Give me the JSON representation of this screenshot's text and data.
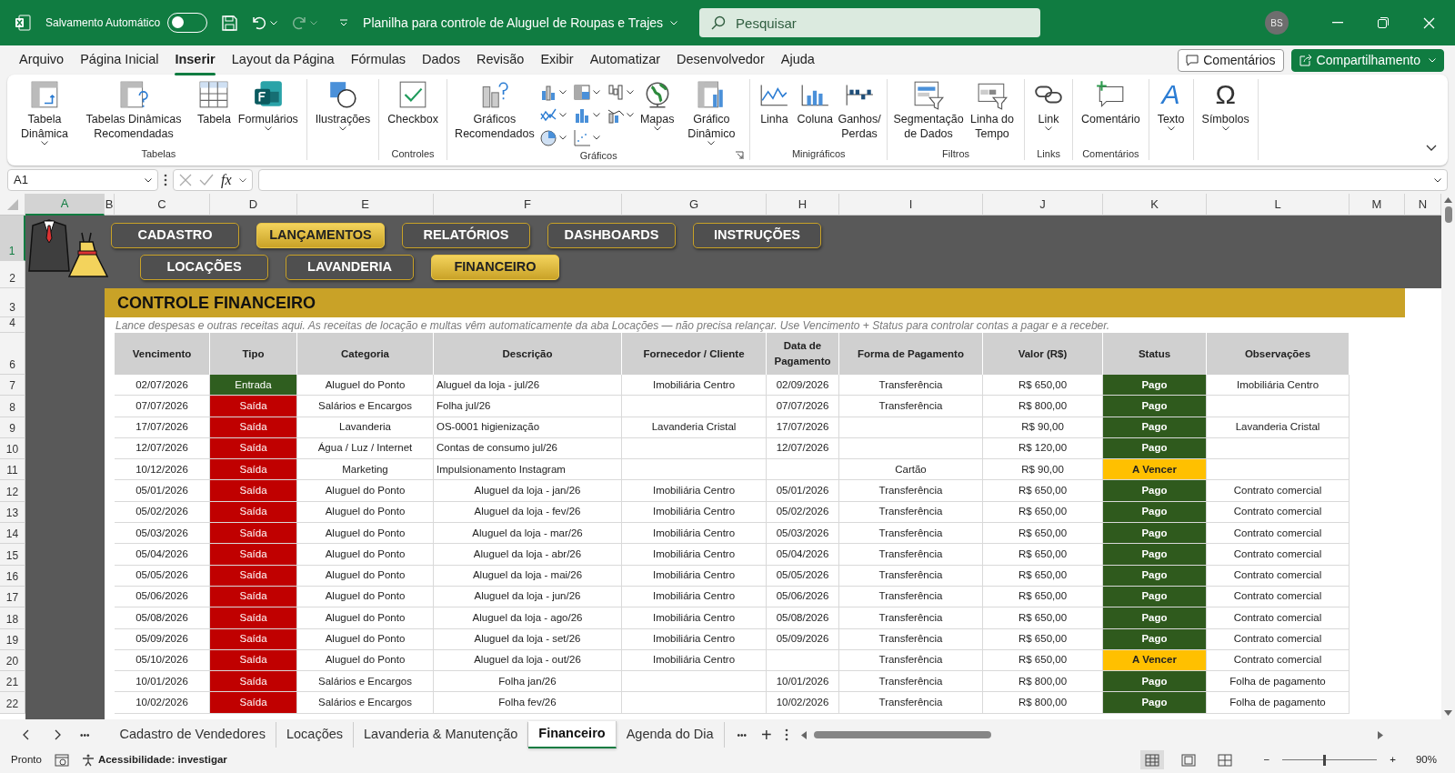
{
  "title_bar": {
    "autosave_label": "Salvamento Automático",
    "autosave_on": false,
    "redo_disabled": true,
    "document_title": "Planilha para controle de Aluguel de Roupas e Trajes",
    "search": {
      "placeholder": "Pesquisar"
    },
    "avatar": "BS"
  },
  "menu_tabs": [
    {
      "label": "Arquivo",
      "selected": false
    },
    {
      "label": "Página Inicial",
      "selected": false
    },
    {
      "label": "Inserir",
      "selected": true
    },
    {
      "label": "Layout da Página",
      "selected": false
    },
    {
      "label": "Fórmulas",
      "selected": false
    },
    {
      "label": "Dados",
      "selected": false
    },
    {
      "label": "Revisão",
      "selected": false
    },
    {
      "label": "Exibir",
      "selected": false
    },
    {
      "label": "Automatizar",
      "selected": false
    },
    {
      "label": "Desenvolvedor",
      "selected": false
    },
    {
      "label": "Ajuda",
      "selected": false
    }
  ],
  "header_buttons": [
    {
      "label": "Comentários",
      "kind": "outline"
    },
    {
      "label": "Compartilhamento",
      "kind": "primary"
    }
  ],
  "ribbon": {
    "groups": [
      {
        "label": "Tabelas",
        "items": [
          {
            "kind": "large",
            "label": "Tabela Dinâmica",
            "caret": true
          },
          {
            "kind": "large",
            "label": "Tabelas Dinâmicas Recomendadas",
            "caret": false
          },
          {
            "kind": "large",
            "label": "Tabela",
            "caret": false
          },
          {
            "kind": "large",
            "label": "Formulários",
            "caret": true
          }
        ]
      },
      {
        "items": [
          {
            "kind": "large",
            "label": "Ilustrações",
            "caret": true
          }
        ]
      },
      {
        "label": "Controles",
        "items": [
          {
            "kind": "large",
            "label": "Checkbox",
            "caret": false
          }
        ]
      },
      {
        "label": "Gráficos",
        "launcher": true,
        "items": [
          {
            "kind": "large",
            "label": "Gráficos Recomendados",
            "caret": false
          },
          {
            "kind": "small_grid",
            "items": [
              {
                "caret": true
              },
              {
                "caret": true
              },
              {
                "caret": true
              },
              {
                "caret": true
              },
              {
                "caret": true
              },
              {
                "caret": true
              },
              {
                "caret": true
              },
              {
                "caret": true
              }
            ]
          },
          {
            "kind": "large",
            "label": "Mapas",
            "caret": true
          },
          {
            "kind": "large",
            "label": "Gráfico Dinâmico",
            "caret": true
          }
        ]
      },
      {
        "label": "Minigráficos",
        "items": [
          {
            "kind": "large",
            "label": "Linha",
            "caret": false
          },
          {
            "kind": "large",
            "label": "Coluna",
            "caret": false
          },
          {
            "kind": "large",
            "label": "Ganhos/ Perdas",
            "caret": false
          }
        ]
      },
      {
        "label": "Filtros",
        "items": [
          {
            "kind": "large",
            "label": "Segmentação de Dados",
            "caret": false
          },
          {
            "kind": "large",
            "label": "Linha do Tempo",
            "caret": false
          }
        ]
      },
      {
        "label": "Links",
        "items": [
          {
            "kind": "large",
            "label": "Link",
            "caret": true
          }
        ]
      },
      {
        "label": "Comentários",
        "items": [
          {
            "kind": "large",
            "label": "Comentário",
            "caret": false
          }
        ]
      },
      {
        "items": [
          {
            "kind": "glyph",
            "glyph": "A",
            "label": "Texto",
            "caret": true
          }
        ]
      },
      {
        "items": [
          {
            "kind": "glyph",
            "glyph": "Ω",
            "label": "Símbolos",
            "caret": true
          }
        ]
      }
    ]
  },
  "formula_bar": {
    "name_box": "A1",
    "fx": "fx"
  },
  "sheet": {
    "columns": [
      {
        "letter": "A",
        "selected": true
      },
      {
        "letter": "B",
        "selected": false
      },
      {
        "letter": "C",
        "selected": false
      },
      {
        "letter": "D",
        "selected": false
      },
      {
        "letter": "E",
        "selected": false
      },
      {
        "letter": "F",
        "selected": false
      },
      {
        "letter": "G",
        "selected": false
      },
      {
        "letter": "H",
        "selected": false
      },
      {
        "letter": "I",
        "selected": false
      },
      {
        "letter": "J",
        "selected": false
      },
      {
        "letter": "K",
        "selected": false
      },
      {
        "letter": "L",
        "selected": false
      },
      {
        "letter": "M",
        "selected": false
      },
      {
        "letter": "N",
        "selected": false
      }
    ],
    "row_headers": [
      {
        "label": "1",
        "selected": true
      },
      {
        "label": "2",
        "selected": false
      },
      {
        "label": "3",
        "selected": false
      },
      {
        "label": "4",
        "selected": false
      },
      {
        "label": "6",
        "selected": false
      },
      {
        "label": "7",
        "selected": false
      },
      {
        "label": "8",
        "selected": false
      },
      {
        "label": "9",
        "selected": false
      },
      {
        "label": "10",
        "selected": false
      },
      {
        "label": "11",
        "selected": false
      },
      {
        "label": "12",
        "selected": false
      },
      {
        "label": "13",
        "selected": false
      },
      {
        "label": "14",
        "selected": false
      },
      {
        "label": "15",
        "selected": false
      },
      {
        "label": "16",
        "selected": false
      },
      {
        "label": "17",
        "selected": false
      },
      {
        "label": "18",
        "selected": false
      },
      {
        "label": "19",
        "selected": false
      },
      {
        "label": "20",
        "selected": false
      },
      {
        "label": "21",
        "selected": false
      },
      {
        "label": "22",
        "selected": false
      }
    ],
    "nav_rows": [
      [
        {
          "label": "CADASTRO",
          "selected": false
        },
        {
          "label": "LANÇAMENTOS",
          "selected": true
        },
        {
          "label": "RELATÓRIOS",
          "selected": false
        },
        {
          "label": "DASHBOARDS",
          "selected": false
        },
        {
          "label": "INSTRUÇÕES",
          "selected": false
        }
      ],
      [
        {
          "label": "LOCAÇÕES",
          "selected": false
        },
        {
          "label": "LAVANDERIA",
          "selected": false
        },
        {
          "label": "FINANCEIRO",
          "selected": true
        }
      ]
    ],
    "title": "CONTROLE FINANCEIRO",
    "note": "Lance despesas e outras receitas aqui. As receitas de locação e multas vêm automaticamente da aba Locações — não precisa relançar. Use Vencimento + Status para controlar contas a pagar e a receber.",
    "headers": [
      "Vencimento",
      "Tipo",
      "Categoria",
      "Descrição",
      "Fornecedor / Cliente",
      "Data de Pagamento",
      "Forma de Pagamento",
      "Valor (R$)",
      "Status",
      "Observações"
    ],
    "rows": [
      {
        "vencimento": "02/07/2026",
        "tipo": {
          "label": "Entrada",
          "kind": "in"
        },
        "categoria": "Aluguel do Ponto",
        "descricao": "Aluguel da loja - jul/26",
        "kind": "left",
        "fornecedor": "Imobiliária Centro",
        "data_pagamento": "02/09/2026",
        "forma": "Transferência",
        "valor": "R$ 650,00",
        "status": {
          "label": "Pago",
          "kind": "paid"
        },
        "observacoes": "Imobiliária Centro"
      },
      {
        "vencimento": "07/07/2026",
        "tipo": {
          "label": "Saída",
          "kind": "out"
        },
        "categoria": "Salários e Encargos",
        "descricao": "Folha jul/26",
        "kind": "left",
        "data_pagamento": "07/07/2026",
        "forma": "Transferência",
        "valor": "R$ 800,00",
        "status": {
          "label": "Pago",
          "kind": "paid"
        }
      },
      {
        "vencimento": "17/07/2026",
        "tipo": {
          "label": "Saída",
          "kind": "out"
        },
        "categoria": "Lavanderia",
        "descricao": "OS-0001 higienização",
        "kind": "left",
        "fornecedor": "Lavanderia Cristal",
        "data_pagamento": "17/07/2026",
        "valor": "R$ 90,00",
        "status": {
          "label": "Pago",
          "kind": "paid"
        },
        "observacoes": "Lavanderia Cristal"
      },
      {
        "vencimento": "12/07/2026",
        "tipo": {
          "label": "Saída",
          "kind": "out"
        },
        "categoria": "Água / Luz / Internet",
        "descricao": "Contas de consumo jul/26",
        "kind": "left",
        "data_pagamento": "12/07/2026",
        "valor": "R$ 120,00",
        "status": {
          "label": "Pago",
          "kind": "paid"
        }
      },
      {
        "vencimento": "10/12/2026",
        "tipo": {
          "label": "Saída",
          "kind": "out"
        },
        "categoria": "Marketing",
        "descricao": "Impulsionamento Instagram",
        "kind": "left",
        "forma": "Cartão",
        "valor": "R$ 90,00",
        "status": {
          "label": "A Vencer",
          "kind": "due"
        }
      },
      {
        "vencimento": "05/01/2026",
        "tipo": {
          "label": "Saída",
          "kind": "out"
        },
        "categoria": "Aluguel do Ponto",
        "descricao": "Aluguel da loja - jan/26",
        "kind": "center",
        "fornecedor": "Imobiliária Centro",
        "data_pagamento": "05/01/2026",
        "forma": "Transferência",
        "valor": "R$ 650,00",
        "status": {
          "label": "Pago",
          "kind": "paid"
        },
        "observacoes": "Contrato comercial"
      },
      {
        "vencimento": "05/02/2026",
        "tipo": {
          "label": "Saída",
          "kind": "out"
        },
        "categoria": "Aluguel do Ponto",
        "descricao": "Aluguel da loja - fev/26",
        "kind": "center",
        "fornecedor": "Imobiliária Centro",
        "data_pagamento": "05/02/2026",
        "forma": "Transferência",
        "valor": "R$ 650,00",
        "status": {
          "label": "Pago",
          "kind": "paid"
        },
        "observacoes": "Contrato comercial"
      },
      {
        "vencimento": "05/03/2026",
        "tipo": {
          "label": "Saída",
          "kind": "out"
        },
        "categoria": "Aluguel do Ponto",
        "descricao": "Aluguel da loja - mar/26",
        "kind": "center",
        "fornecedor": "Imobiliária Centro",
        "data_pagamento": "05/03/2026",
        "forma": "Transferência",
        "valor": "R$ 650,00",
        "status": {
          "label": "Pago",
          "kind": "paid"
        },
        "observacoes": "Contrato comercial"
      },
      {
        "vencimento": "05/04/2026",
        "tipo": {
          "label": "Saída",
          "kind": "out"
        },
        "categoria": "Aluguel do Ponto",
        "descricao": "Aluguel da loja - abr/26",
        "kind": "center",
        "fornecedor": "Imobiliária Centro",
        "data_pagamento": "05/04/2026",
        "forma": "Transferência",
        "valor": "R$ 650,00",
        "status": {
          "label": "Pago",
          "kind": "paid"
        },
        "observacoes": "Contrato comercial"
      },
      {
        "vencimento": "05/05/2026",
        "tipo": {
          "label": "Saída",
          "kind": "out"
        },
        "categoria": "Aluguel do Ponto",
        "descricao": "Aluguel da loja - mai/26",
        "kind": "center",
        "fornecedor": "Imobiliária Centro",
        "data_pagamento": "05/05/2026",
        "forma": "Transferência",
        "valor": "R$ 650,00",
        "status": {
          "label": "Pago",
          "kind": "paid"
        },
        "observacoes": "Contrato comercial"
      },
      {
        "vencimento": "05/06/2026",
        "tipo": {
          "label": "Saída",
          "kind": "out"
        },
        "categoria": "Aluguel do Ponto",
        "descricao": "Aluguel da loja - jun/26",
        "kind": "center",
        "fornecedor": "Imobiliária Centro",
        "data_pagamento": "05/06/2026",
        "forma": "Transferência",
        "valor": "R$ 650,00",
        "status": {
          "label": "Pago",
          "kind": "paid"
        },
        "observacoes": "Contrato comercial"
      },
      {
        "vencimento": "05/08/2026",
        "tipo": {
          "label": "Saída",
          "kind": "out"
        },
        "categoria": "Aluguel do Ponto",
        "descricao": "Aluguel da loja - ago/26",
        "kind": "center",
        "fornecedor": "Imobiliária Centro",
        "data_pagamento": "05/08/2026",
        "forma": "Transferência",
        "valor": "R$ 650,00",
        "status": {
          "label": "Pago",
          "kind": "paid"
        },
        "observacoes": "Contrato comercial"
      },
      {
        "vencimento": "05/09/2026",
        "tipo": {
          "label": "Saída",
          "kind": "out"
        },
        "categoria": "Aluguel do Ponto",
        "descricao": "Aluguel da loja - set/26",
        "kind": "center",
        "fornecedor": "Imobiliária Centro",
        "data_pagamento": "05/09/2026",
        "forma": "Transferência",
        "valor": "R$ 650,00",
        "status": {
          "label": "Pago",
          "kind": "paid"
        },
        "observacoes": "Contrato comercial"
      },
      {
        "vencimento": "05/10/2026",
        "tipo": {
          "label": "Saída",
          "kind": "out"
        },
        "categoria": "Aluguel do Ponto",
        "descricao": "Aluguel da loja - out/26",
        "kind": "center",
        "fornecedor": "Imobiliária Centro",
        "forma": "Transferência",
        "valor": "R$ 650,00",
        "status": {
          "label": "A Vencer",
          "kind": "due"
        },
        "observacoes": "Contrato comercial"
      },
      {
        "vencimento": "10/01/2026",
        "tipo": {
          "label": "Saída",
          "kind": "out"
        },
        "categoria": "Salários e Encargos",
        "descricao": "Folha jan/26",
        "kind": "center",
        "data_pagamento": "10/01/2026",
        "forma": "Transferência",
        "valor": "R$ 800,00",
        "status": {
          "label": "Pago",
          "kind": "paid"
        },
        "observacoes": "Folha de pagamento"
      },
      {
        "vencimento": "10/02/2026",
        "tipo": {
          "label": "Saída",
          "kind": "out"
        },
        "categoria": "Salários e Encargos",
        "descricao": "Folha fev/26",
        "kind": "center",
        "data_pagamento": "10/02/2026",
        "forma": "Transferência",
        "valor": "R$ 800,00",
        "status": {
          "label": "Pago",
          "kind": "paid"
        },
        "observacoes": "Folha de pagamento"
      }
    ]
  },
  "sheet_tabs": {
    "more_left": "•••",
    "tabs": [
      {
        "label": "Cadastro de Vendedores",
        "selected": false
      },
      {
        "label": "Locações",
        "selected": false
      },
      {
        "label": "Lavanderia & Manutenção",
        "selected": false
      },
      {
        "label": "Financeiro",
        "selected": true
      },
      {
        "label": "Agenda do Dia",
        "selected": false
      }
    ],
    "more_right": "•••",
    "add": "+"
  },
  "status_bar": {
    "status": "Pronto",
    "accessibility": "Acessibilidade: investigar",
    "views": [
      {
        "selected": true
      },
      {
        "selected": false
      },
      {
        "selected": false
      }
    ],
    "zoom": {
      "minus": "−",
      "plus": "+",
      "level": 0.43,
      "reading": "90%"
    }
  }
}
